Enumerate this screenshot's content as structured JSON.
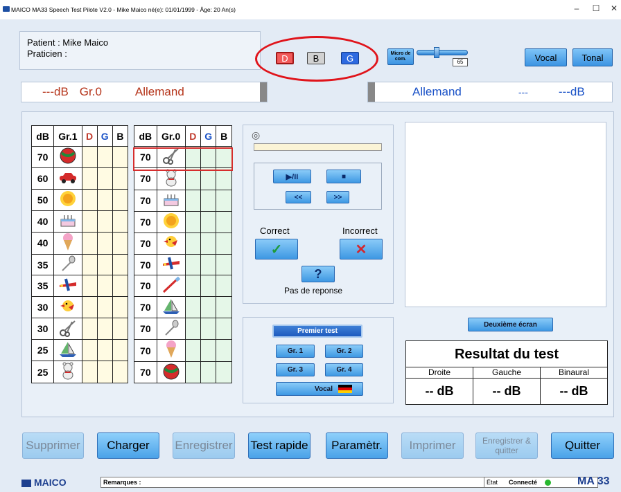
{
  "window": {
    "title": "MAICO MA33 Speech Test Pilote V2.0 - Mike Maico   né(e): 01/01/1999 - Âge: 20 An(s)",
    "minimize": "–",
    "maximize": "☐",
    "close": "✕"
  },
  "patient": {
    "patient_line": "Patient   : Mike Maico",
    "praticien_line": "Praticien :"
  },
  "channels": {
    "right": "D",
    "both": "B",
    "left": "G"
  },
  "micro": {
    "label": "Micro de com.",
    "value": "65"
  },
  "top_buttons": {
    "vocal": "Vocal",
    "tonal": "Tonal"
  },
  "left_header": {
    "db": "---dB",
    "group": "Gr.0",
    "language": "Allemand"
  },
  "right_header": {
    "language": "Allemand",
    "mid": "---",
    "db": "---dB"
  },
  "table1": {
    "headers": [
      "dB",
      "Gr.1",
      "D",
      "G",
      "B"
    ],
    "rows": [
      {
        "db": "70",
        "icon": "ball-icon"
      },
      {
        "db": "60",
        "icon": "car-icon"
      },
      {
        "db": "50",
        "icon": "sun-icon"
      },
      {
        "db": "40",
        "icon": "cake-icon"
      },
      {
        "db": "40",
        "icon": "ice-cream-icon"
      },
      {
        "db": "35",
        "icon": "spoon-icon"
      },
      {
        "db": "35",
        "icon": "airplane-icon"
      },
      {
        "db": "30",
        "icon": "bird-icon"
      },
      {
        "db": "30",
        "icon": "scissors-icon"
      },
      {
        "db": "25",
        "icon": "sailboat-icon"
      },
      {
        "db": "25",
        "icon": "teddy-bear-icon"
      }
    ]
  },
  "table2": {
    "headers": [
      "dB",
      "Gr.0",
      "D",
      "G",
      "B"
    ],
    "rows": [
      {
        "db": "70",
        "icon": "scissors-icon"
      },
      {
        "db": "70",
        "icon": "teddy-bear-icon"
      },
      {
        "db": "70",
        "icon": "cake-icon"
      },
      {
        "db": "70",
        "icon": "sun-icon"
      },
      {
        "db": "70",
        "icon": "bird-icon"
      },
      {
        "db": "70",
        "icon": "airplane-icon"
      },
      {
        "db": "70",
        "icon": "toothbrush-icon"
      },
      {
        "db": "70",
        "icon": "sailboat-icon"
      },
      {
        "db": "70",
        "icon": "spoon-icon"
      },
      {
        "db": "70",
        "icon": "ice-cream-icon"
      },
      {
        "db": "70",
        "icon": "ball-icon"
      }
    ]
  },
  "player": {
    "play_pause": "▶/II",
    "stop": "■",
    "rewind": "<<",
    "forward": ">>"
  },
  "answers": {
    "correct": "Correct",
    "incorrect": "Incorrect",
    "no_answer_symbol": "?",
    "no_answer": "Pas de reponse"
  },
  "tests": {
    "premier": "Premier test",
    "gr1": "Gr. 1",
    "gr2": "Gr. 2",
    "gr3": "Gr. 3",
    "gr4": "Gr. 4",
    "vocal": "Vocal"
  },
  "second_screen": "Deuxième écran",
  "result": {
    "title": "Resultat du test",
    "headers": [
      "Droite",
      "Gauche",
      "Binaural"
    ],
    "values": [
      "-- dB",
      "-- dB",
      "-- dB"
    ]
  },
  "bottom": {
    "supprimer": "Supprimer",
    "charger": "Charger",
    "enregistrer": "Enregistrer",
    "test_rapide": "Test rapide",
    "parametres": "Paramètr.",
    "imprimer": "Imprimer",
    "enregistrer_quitter": "Enregistrer & quitter",
    "quitter": "Quitter"
  },
  "statusbar": {
    "brand": "MAICO",
    "remarks": "Remarques :",
    "state_label": "État",
    "state_value": "Connecté",
    "model": "MA 33"
  },
  "colors": {
    "accent": "#3c94e2",
    "right_channel": "#e53935",
    "left_channel": "#1a52c7",
    "annotation": "#e0141b"
  }
}
